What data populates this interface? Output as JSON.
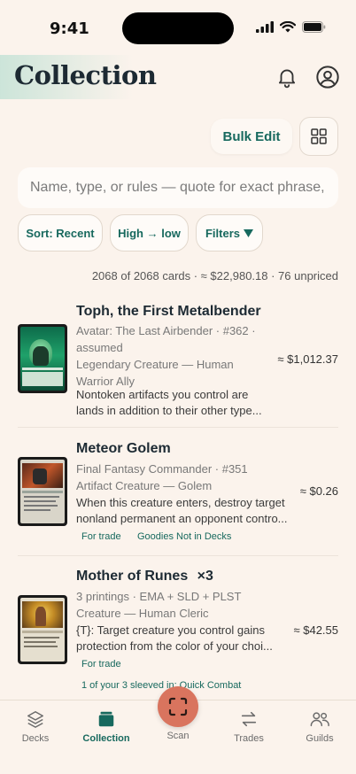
{
  "status_bar": {
    "time": "9:41"
  },
  "header": {
    "title": "Collection"
  },
  "toolbar": {
    "bulk_edit_label": "Bulk Edit"
  },
  "search": {
    "placeholder": "Name, type, or rules — quote for exact phrase, \""
  },
  "chips": {
    "sort": "Sort: Recent",
    "order": "High → low",
    "filters": "Filters"
  },
  "summary": "2068 of 2068 cards · ≈ $22,980.18 · 76 unpriced",
  "cards": [
    {
      "name": "Toph, the First Metalbender",
      "set_line": "Avatar: The Last Airbender · #362 ·",
      "set_line2": "assumed",
      "type_line": "Legendary Creature — Human",
      "type_line2": "Warrior Ally",
      "rules_line1": "Nontoken artifacts you control are",
      "rules_line2": "lands in addition to their other type...",
      "price": "≈ $1,012.37",
      "tags": []
    },
    {
      "name": "Meteor Golem",
      "set_line": "Final Fantasy Commander · #351",
      "type_line": "Artifact Creature — Golem",
      "rules_line1": "When this creature enters, destroy target",
      "rules_line2": "nonland permanent an opponent contro...",
      "price": "≈ $0.26",
      "tags": [
        "For trade",
        "Goodies Not in Decks"
      ]
    },
    {
      "name": "Mother of Runes",
      "qty": "×3",
      "set_line": "3 printings · EMA + SLD + PLST",
      "type_line": "Creature — Human Cleric",
      "rules_line1": "{T}: Target creature you control gains",
      "rules_line2": "protection from the color of your choi...",
      "price": "≈ $42.55",
      "tags": [
        "For trade"
      ],
      "note": "1 of your 3 sleeved in: Quick Combat"
    }
  ],
  "nav": {
    "decks": "Decks",
    "collection": "Collection",
    "scan": "Scan",
    "trades": "Trades",
    "guilds": "Guilds"
  },
  "colors": {
    "accent": "#17695e",
    "background": "#fbf3ec",
    "scan_button": "#d9745e"
  }
}
